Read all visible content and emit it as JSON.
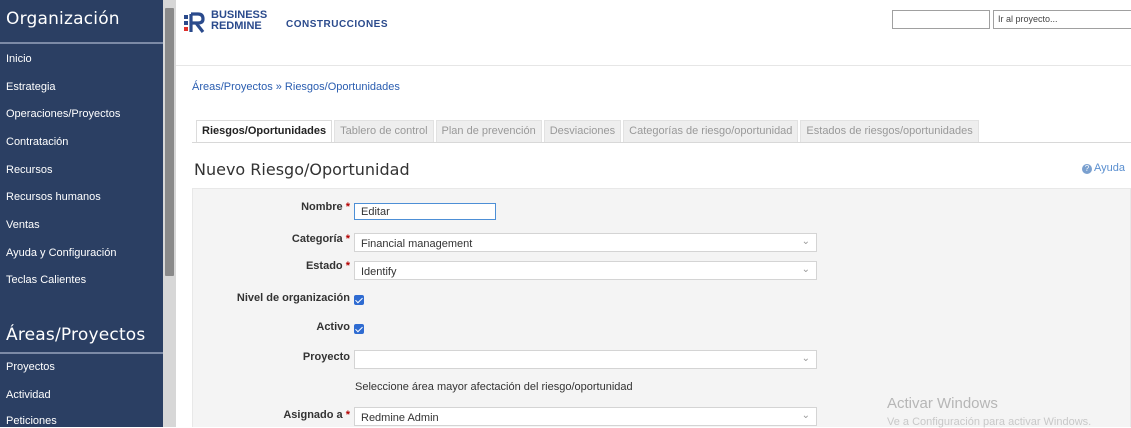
{
  "sidebar": {
    "org_title": "Organización",
    "org_items": [
      {
        "label": "Inicio"
      },
      {
        "label": "Estrategia"
      },
      {
        "label": "Operaciones/Proyectos"
      },
      {
        "label": "Contratación"
      },
      {
        "label": "Recursos"
      },
      {
        "label": "Recursos humanos"
      },
      {
        "label": "Ventas"
      },
      {
        "label": "Ayuda y Configuración"
      },
      {
        "label": "Teclas Calientes"
      }
    ],
    "areas_title": "Áreas/Proyectos",
    "areas_items": [
      {
        "label": "Proyectos"
      },
      {
        "label": "Actividad"
      },
      {
        "label": "Peticiones"
      }
    ]
  },
  "header": {
    "logo_line1": "BUSINESS",
    "logo_line2": "REDMINE",
    "app_name": "CONSTRUCCIONES",
    "project_jump": "Ir al proyecto..."
  },
  "breadcrumb": "Áreas/Proyectos » Riesgos/Oportunidades",
  "tabs": [
    {
      "label": "Riesgos/Oportunidades",
      "active": true
    },
    {
      "label": "Tablero de control"
    },
    {
      "label": "Plan de prevención"
    },
    {
      "label": "Desviaciones"
    },
    {
      "label": "Categorías de riesgo/oportunidad"
    },
    {
      "label": "Estados de riesgos/oportunidades"
    }
  ],
  "page_title": "Nuevo Riesgo/Oportunidad",
  "help_label": "Ayuda",
  "form": {
    "nombre_label": "Nombre",
    "nombre_value": "Editar",
    "categoria_label": "Categoría",
    "categoria_value": "Financial management",
    "estado_label": "Estado",
    "estado_value": "Identify",
    "nivel_label": "Nivel de organización",
    "activo_label": "Activo",
    "proyecto_label": "Proyecto",
    "proyecto_value": "",
    "proyecto_hint": "Seleccione área mayor afectación del riesgo/oportunidad",
    "asignado_label": "Asignado a",
    "asignado_value": "Redmine Admin",
    "required_mark": "*"
  },
  "watermark": {
    "line1": "Activar Windows",
    "line2": "Ve a Configuración para activar Windows."
  },
  "colors": {
    "sidebar_bg": "#2b3f63",
    "link": "#2a5db0",
    "required": "#b40000",
    "checkbox": "#2e6bd1"
  }
}
